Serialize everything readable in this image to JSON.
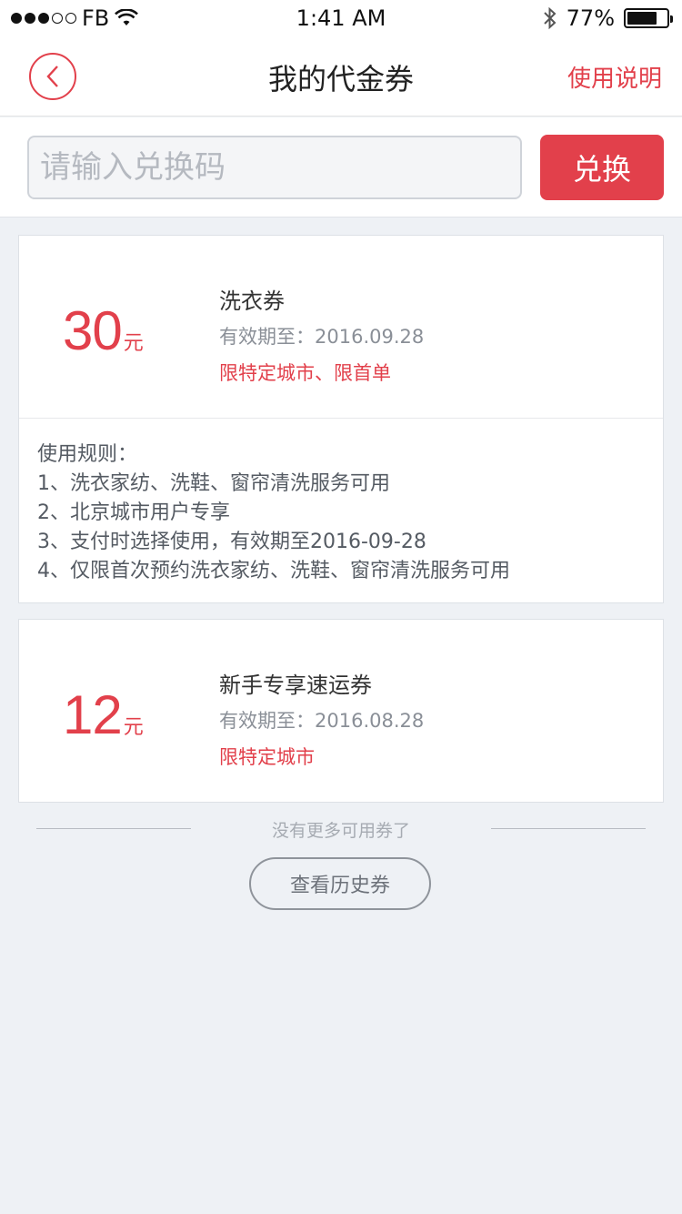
{
  "status_bar": {
    "carrier": "FB",
    "time": "1:41 AM",
    "battery": "77%",
    "battery_level": 0.77
  },
  "nav": {
    "title": "我的代金券",
    "help_label": "使用说明"
  },
  "redeem": {
    "placeholder": "请输入兑换码",
    "button_label": "兑换"
  },
  "coupons": [
    {
      "amount": "30",
      "unit": "元",
      "name": "洗衣券",
      "valid": "有效期至：2016.09.28",
      "limit": "限特定城市、限首单",
      "rules_title": "使用规则：",
      "rules": [
        "1、洗衣家纺、洗鞋、窗帘清洗服务可用",
        "2、北京城市用户专享",
        "3、支付时选择使用，有效期至2016-09-28",
        "4、仅限首次预约洗衣家纺、洗鞋、窗帘清洗服务可用"
      ]
    },
    {
      "amount": "12",
      "unit": "元",
      "name": "新手专享速运券",
      "valid": "有效期至：2016.08.28",
      "limit": "限特定城市"
    }
  ],
  "footer": {
    "no_more_text": "没有更多可用券了",
    "history_label": "查看历史券"
  },
  "colors": {
    "accent": "#e2404b",
    "background": "#eef1f5"
  }
}
